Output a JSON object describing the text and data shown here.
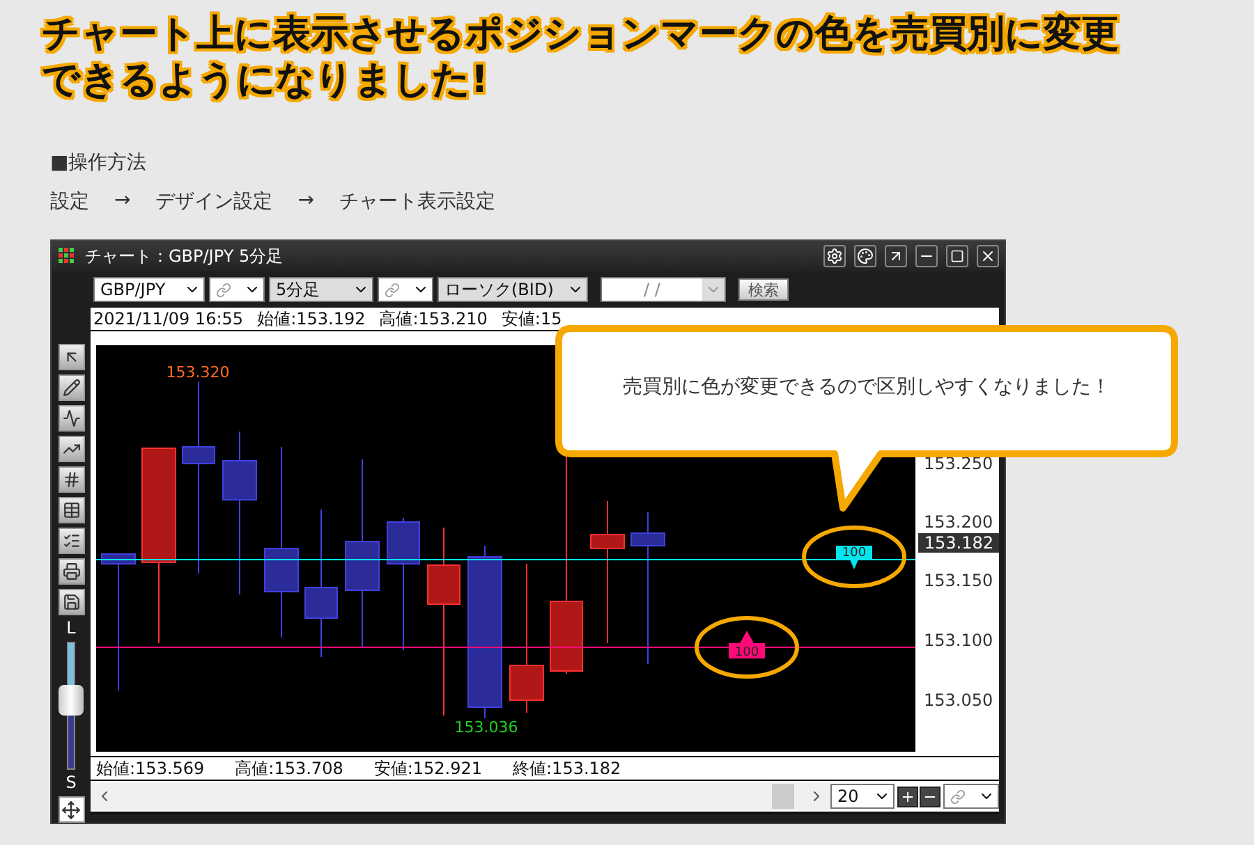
{
  "headline": "チャート上に表示させるポジションマークの色を売買別に変更できるようになりました!",
  "section_label": "■操作方法",
  "breadcrumb": [
    {
      "label": "設定"
    },
    {
      "label": "→",
      "kind": "arrow"
    },
    {
      "label": "デザイン設定"
    },
    {
      "label": "→",
      "kind": "arrow"
    },
    {
      "label": "チャート表示設定"
    }
  ],
  "window": {
    "title": "チャート：GBP/JPY 5分足"
  },
  "toolbar": {
    "symbol": "GBP/JPY",
    "timeframe": "5分足",
    "chart_type": "ローソク(BID)",
    "date": {
      "value": "/ /",
      "disabled": true
    },
    "search_button": "検索"
  },
  "info_row": [
    "2021/11/09 16:55",
    "始値:153.192",
    "高値:153.210",
    "安値:15"
  ],
  "zoom_slider": {
    "top_label": "L",
    "bottom_label": "S",
    "level": 0.55
  },
  "chart": {
    "high_label": "153.320",
    "low_label": "153.036",
    "y_ticks": [
      "153.250",
      "153.200",
      "153.150",
      "153.100",
      "153.050"
    ],
    "current_price": "153.182",
    "position_marks": [
      {
        "kind": "sell",
        "label": "100",
        "color": "#00e5ee"
      },
      {
        "kind": "buy",
        "label": "100",
        "color": "#ff0a78"
      }
    ]
  },
  "bottom_info": [
    "始値:153.569",
    "高値:153.708",
    "安値:152.921",
    "終値:153.182"
  ],
  "scroll_row": {
    "period": "20"
  },
  "callout": {
    "text": "売買別に色が変更できるので区別しやすくなりました！"
  }
}
